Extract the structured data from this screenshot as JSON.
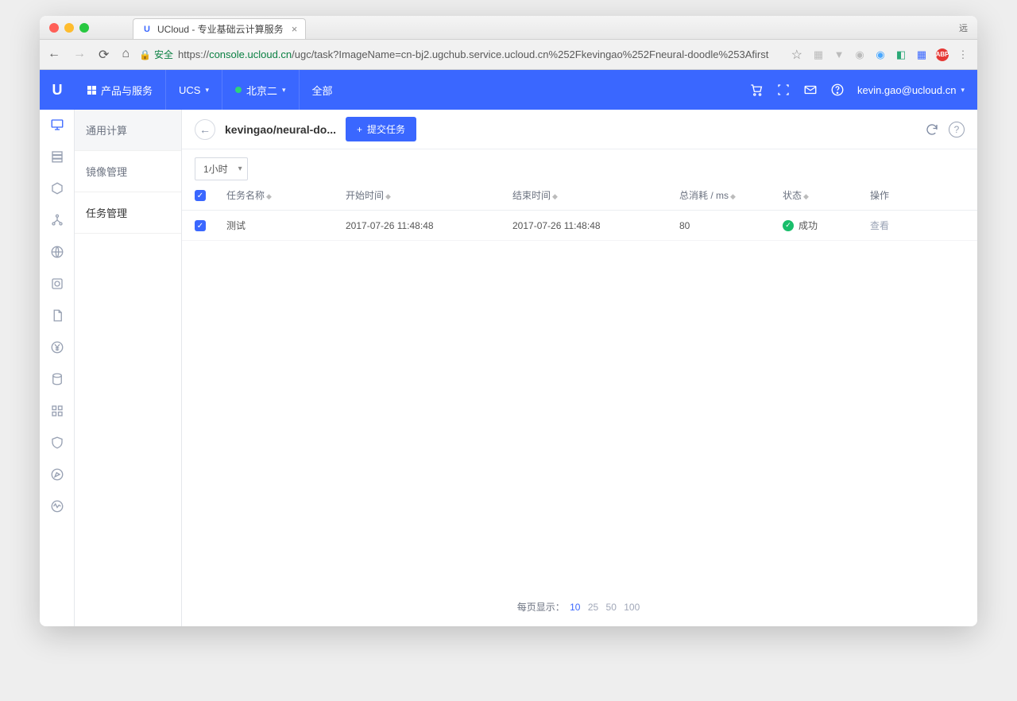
{
  "browser": {
    "tab_title": "UCloud - 专业基础云计算服务",
    "right_indicator": "远",
    "secure_label": "安全",
    "url_host": "console.ucloud.cn",
    "url_prefix": "https://",
    "url_path": "/ugc/task?ImageName=cn-bj2.ugchub.service.ucloud.cn%252Fkevingao%252Fneural-doodle%253Afirst"
  },
  "topnav": {
    "products": "产品与服务",
    "project": "UCS",
    "region": "北京二",
    "scope": "全部",
    "user": "kevin.gao@ucloud.cn"
  },
  "sidebar": {
    "section": "通用计算",
    "items": [
      "镜像管理",
      "任务管理"
    ]
  },
  "header": {
    "breadcrumb": "kevingao/neural-do...",
    "submit_btn": "提交任务"
  },
  "filter": {
    "time_range": "1小时"
  },
  "table": {
    "cols": [
      "任务名称",
      "开始时间",
      "结束时间",
      "总消耗 / ms",
      "状态",
      "操作"
    ],
    "rows": [
      {
        "name": "测试",
        "start": "2017-07-26 11:48:48",
        "end": "2017-07-26 11:48:48",
        "cost": "80",
        "status": "成功",
        "action": "查看"
      }
    ]
  },
  "pager": {
    "label": "每页显示：",
    "sizes": [
      "10",
      "25",
      "50",
      "100"
    ],
    "active": "10"
  }
}
